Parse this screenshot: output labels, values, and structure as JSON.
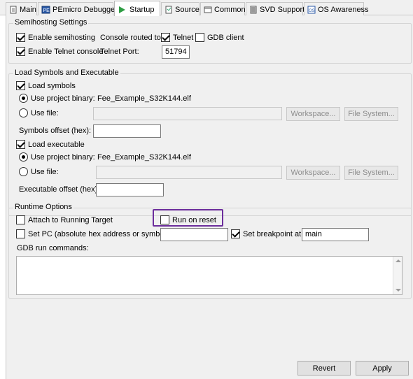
{
  "tabs": [
    {
      "label": "Main",
      "icon": "document-icon"
    },
    {
      "label": "PEmicro Debugger",
      "icon": "debugger-icon"
    },
    {
      "label": "Startup",
      "icon": "startup-play-icon"
    },
    {
      "label": "Source",
      "icon": "source-icon"
    },
    {
      "label": "Common",
      "icon": "common-icon"
    },
    {
      "label": "SVD Support",
      "icon": "svd-icon"
    },
    {
      "label": "OS Awareness",
      "icon": "os-icon"
    }
  ],
  "semihosting": {
    "title": "Semihosting Settings",
    "enable_semihosting": "Enable semihosting",
    "console_routed_to": "Console routed to:",
    "telnet": "Telnet",
    "gdb_client": "GDB client",
    "enable_telnet_console": "Enable Telnet console",
    "telnet_port_label": "Telnet Port:",
    "telnet_port_value": "51794"
  },
  "load": {
    "title": "Load Symbols and Executable",
    "load_symbols": "Load symbols",
    "use_project_binary": "Use project binary:",
    "symbols_binary": "Fee_Example_S32K144.elf",
    "use_file": "Use file:",
    "workspace": "Workspace...",
    "file_system": "File System...",
    "symbols_offset": "Symbols offset (hex):",
    "load_executable": "Load executable",
    "exec_binary": "Fee_Example_S32K144.elf",
    "executable_offset": "Executable offset (hex):"
  },
  "runtime": {
    "title": "Runtime Options",
    "attach": "Attach to Running Target",
    "run_on_reset": "Run on reset",
    "set_pc": "Set PC (absolute hex address or symbol):",
    "set_breakpoint": "Set breakpoint at:",
    "breakpoint_value": "main",
    "gdb_run_commands": "GDB run commands:"
  },
  "buttons": {
    "revert": "Revert",
    "apply": "Apply"
  },
  "colors": {
    "highlight": "#6c2d9c"
  }
}
